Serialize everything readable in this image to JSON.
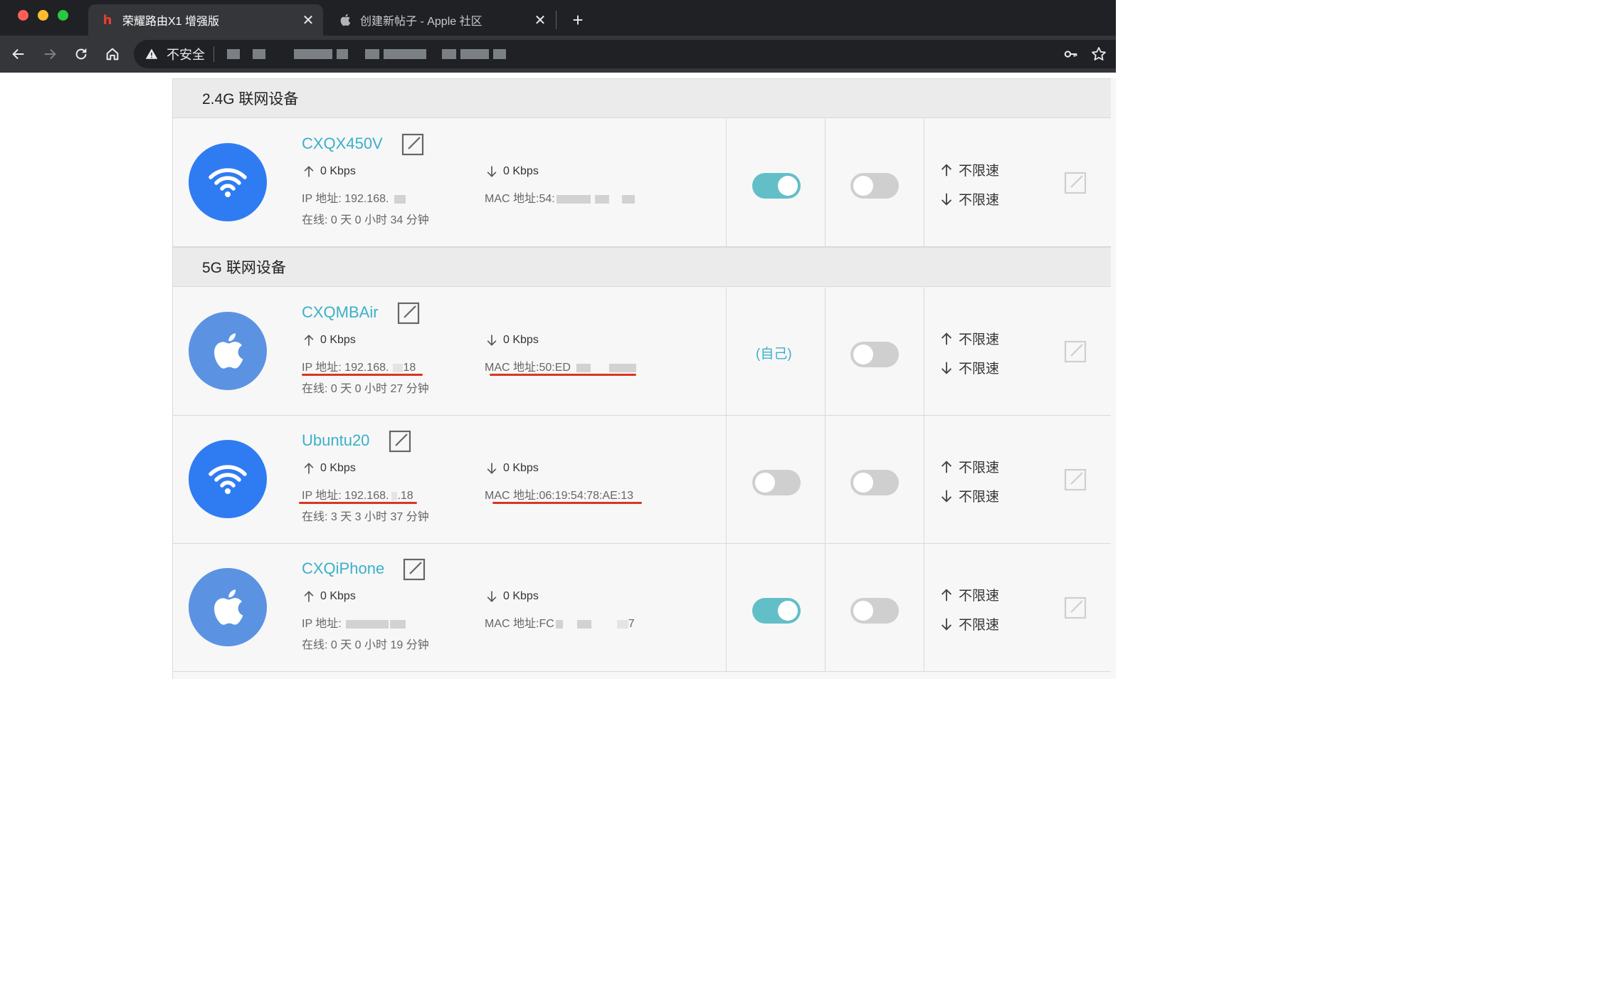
{
  "browser": {
    "tabs": [
      {
        "title": "荣耀路由X1 增强版",
        "favicon": "honor-logo",
        "active": true
      },
      {
        "title": "创建新帖子 - Apple 社区",
        "favicon": "apple-logo",
        "active": false
      }
    ],
    "new_tab_label": "+",
    "close_label": "✕",
    "security_label": "不安全"
  },
  "sections": [
    {
      "title": "2.4G 联网设备"
    },
    {
      "title": "5G 联网设备"
    }
  ],
  "devices": [
    {
      "name": "CXQX450V",
      "icon": "wifi-icon",
      "up": "0 Kbps",
      "down": "0 Kbps",
      "ip": "IP 地址: 192.168.",
      "mac": "MAC 地址:54:",
      "online": "在线: 0 天 0 小时 34 分钟",
      "access_enabled": true,
      "self_label": "",
      "second_toggle_enabled": false,
      "upload_limit": "不限速",
      "download_limit": "不限速"
    },
    {
      "name": "CXQMBAir",
      "icon": "apple-icon",
      "up": "0 Kbps",
      "down": "0 Kbps",
      "ip": "IP 地址: 192.168.",
      "ip_tail": "18",
      "mac": "MAC 地址:50:ED",
      "online": "在线: 0 天 0 小时 27 分钟",
      "access_enabled": null,
      "self_label": "(自己)",
      "second_toggle_enabled": false,
      "upload_limit": "不限速",
      "download_limit": "不限速"
    },
    {
      "name": "Ubuntu20",
      "icon": "wifi-icon",
      "up": "0 Kbps",
      "down": "0 Kbps",
      "ip": "IP 地址: 192.168.",
      "ip_tail": ".18",
      "mac": "MAC 地址:06:19:54:78:AE:13",
      "online": "在线: 3 天 3 小时 37 分钟",
      "access_enabled": false,
      "self_label": "",
      "second_toggle_enabled": false,
      "upload_limit": "不限速",
      "download_limit": "不限速"
    },
    {
      "name": "CXQiPhone",
      "icon": "apple-icon",
      "up": "0 Kbps",
      "down": "0 Kbps",
      "ip": "IP 地址:",
      "mac": "MAC 地址:FC",
      "mac_tail": "7",
      "online": "在线: 0 天 0 小时 19 分钟",
      "access_enabled": true,
      "self_label": "",
      "second_toggle_enabled": false,
      "upload_limit": "不限速",
      "download_limit": "不限速"
    }
  ],
  "colors": {
    "accent": "#3bb0c9",
    "toggle_on": "#62bfc7",
    "toggle_off": "#cfcfcf",
    "wifi_avatar": "#2f7cf2",
    "apple_avatar": "#5b93e2",
    "annotation": "#d9371f"
  }
}
